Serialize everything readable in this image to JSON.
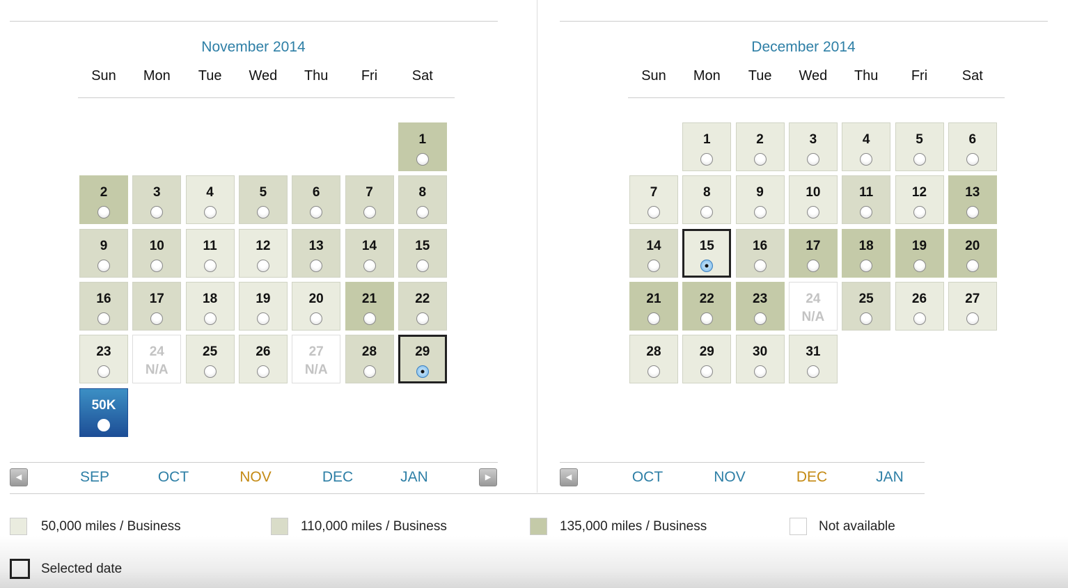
{
  "colors": {
    "level_50k": "#eaecdf",
    "level_110k": "#d9dcc8",
    "level_135k": "#c4caa8",
    "accent": "#2e7fa6",
    "current_month": "#c48a14"
  },
  "weekdays": [
    "Sun",
    "Mon",
    "Tue",
    "Wed",
    "Thu",
    "Fri",
    "Sat"
  ],
  "calendars": [
    {
      "title": "November 2014",
      "first_weekday": 6,
      "days": [
        [
          "1",
          "D"
        ],
        [
          "2",
          "D"
        ],
        [
          "3",
          "M"
        ],
        [
          "4",
          "L"
        ],
        [
          "5",
          "M"
        ],
        [
          "6",
          "M"
        ],
        [
          "7",
          "M"
        ],
        [
          "8",
          "M"
        ],
        [
          "9",
          "M"
        ],
        [
          "10",
          "M"
        ],
        [
          "11",
          "L"
        ],
        [
          "12",
          "L"
        ],
        [
          "13",
          "M"
        ],
        [
          "14",
          "M"
        ],
        [
          "15",
          "M"
        ],
        [
          "16",
          "M"
        ],
        [
          "17",
          "M"
        ],
        [
          "18",
          "L"
        ],
        [
          "19",
          "L"
        ],
        [
          "20",
          "L"
        ],
        [
          "21",
          "D"
        ],
        [
          "22",
          "M"
        ],
        [
          "23",
          "L"
        ],
        [
          "24",
          "NA"
        ],
        [
          "25",
          "L"
        ],
        [
          "26",
          "L"
        ],
        [
          "27",
          "NA"
        ],
        [
          "28",
          "M"
        ],
        [
          "29",
          "M",
          "selected"
        ],
        [
          "50K",
          "L",
          "hover"
        ]
      ],
      "nav": {
        "months": [
          "SEP",
          "OCT",
          "NOV",
          "DEC",
          "JAN"
        ],
        "current": "NOV",
        "has_next": true
      }
    },
    {
      "title": "December 2014",
      "first_weekday": 1,
      "days": [
        [
          "1",
          "L"
        ],
        [
          "2",
          "L"
        ],
        [
          "3",
          "L"
        ],
        [
          "4",
          "L"
        ],
        [
          "5",
          "L"
        ],
        [
          "6",
          "L"
        ],
        [
          "7",
          "L"
        ],
        [
          "8",
          "L"
        ],
        [
          "9",
          "L"
        ],
        [
          "10",
          "L"
        ],
        [
          "11",
          "M"
        ],
        [
          "12",
          "L"
        ],
        [
          "13",
          "D"
        ],
        [
          "14",
          "M"
        ],
        [
          "15",
          "L",
          "selected"
        ],
        [
          "16",
          "M"
        ],
        [
          "17",
          "D"
        ],
        [
          "18",
          "D"
        ],
        [
          "19",
          "D"
        ],
        [
          "20",
          "D"
        ],
        [
          "21",
          "D"
        ],
        [
          "22",
          "D"
        ],
        [
          "23",
          "D"
        ],
        [
          "24",
          "NA"
        ],
        [
          "25",
          "M"
        ],
        [
          "26",
          "L"
        ],
        [
          "27",
          "L"
        ],
        [
          "28",
          "L"
        ],
        [
          "29",
          "L"
        ],
        [
          "30",
          "L"
        ],
        [
          "31",
          "L"
        ]
      ],
      "nav": {
        "months": [
          "OCT",
          "NOV",
          "DEC",
          "JAN"
        ],
        "current": "DEC",
        "has_next": false
      }
    }
  ],
  "na_label": "N/A",
  "legend": {
    "l50": "50,000 miles / Business",
    "l110": "110,000 miles / Business",
    "l135": "135,000 miles / Business",
    "na": "Not available",
    "selected": "Selected date"
  }
}
